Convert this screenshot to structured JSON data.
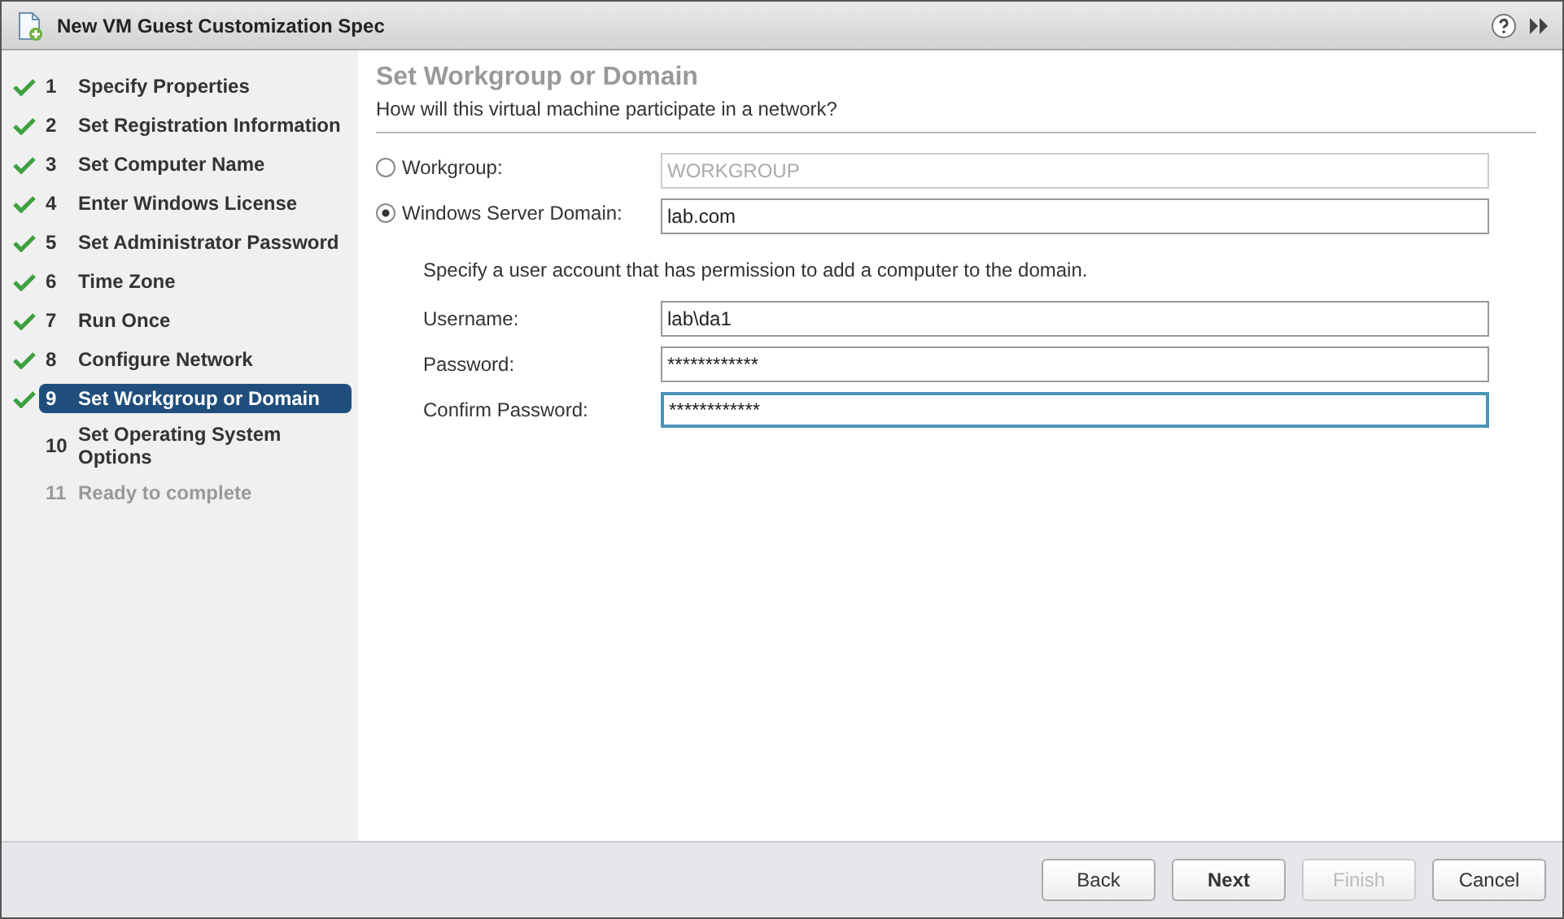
{
  "window": {
    "title": "New VM Guest Customization Spec"
  },
  "steps": [
    {
      "number": "1",
      "label": "Specify Properties",
      "completed": true,
      "selected": false,
      "disabled": false
    },
    {
      "number": "2",
      "label": "Set Registration Information",
      "completed": true,
      "selected": false,
      "disabled": false
    },
    {
      "number": "3",
      "label": "Set Computer Name",
      "completed": true,
      "selected": false,
      "disabled": false
    },
    {
      "number": "4",
      "label": "Enter Windows License",
      "completed": true,
      "selected": false,
      "disabled": false
    },
    {
      "number": "5",
      "label": "Set Administrator Password",
      "completed": true,
      "selected": false,
      "disabled": false
    },
    {
      "number": "6",
      "label": "Time Zone",
      "completed": true,
      "selected": false,
      "disabled": false
    },
    {
      "number": "7",
      "label": "Run Once",
      "completed": true,
      "selected": false,
      "disabled": false
    },
    {
      "number": "8",
      "label": "Configure Network",
      "completed": true,
      "selected": false,
      "disabled": false
    },
    {
      "number": "9",
      "label": "Set Workgroup or Domain",
      "completed": true,
      "selected": true,
      "disabled": false
    },
    {
      "number": "10",
      "label": "Set Operating System Options",
      "completed": false,
      "selected": false,
      "disabled": false
    },
    {
      "number": "11",
      "label": "Ready to complete",
      "completed": false,
      "selected": false,
      "disabled": true
    }
  ],
  "page": {
    "title": "Set Workgroup or Domain",
    "subtitle": "How will this virtual machine participate in a network?"
  },
  "membership": [
    {
      "label": "Workgroup:",
      "selected": false,
      "value": "WORKGROUP",
      "disabled": true
    },
    {
      "label": "Windows Server Domain:",
      "selected": true,
      "value": "lab.com",
      "disabled": false
    }
  ],
  "account": {
    "hint": "Specify a user account that has permission to add a computer to the domain.",
    "fields": [
      {
        "label": "Username:",
        "value": "lab\\da1",
        "focused": false
      },
      {
        "label": "Password:",
        "value": "************",
        "focused": false
      },
      {
        "label": "Confirm Password:",
        "value": "************",
        "focused": true
      }
    ]
  },
  "buttons": [
    {
      "label": "Back",
      "default": false,
      "disabled": false
    },
    {
      "label": "Next",
      "default": true,
      "disabled": false
    },
    {
      "label": "Finish",
      "default": false,
      "disabled": true
    },
    {
      "label": "Cancel",
      "default": false,
      "disabled": false
    }
  ]
}
